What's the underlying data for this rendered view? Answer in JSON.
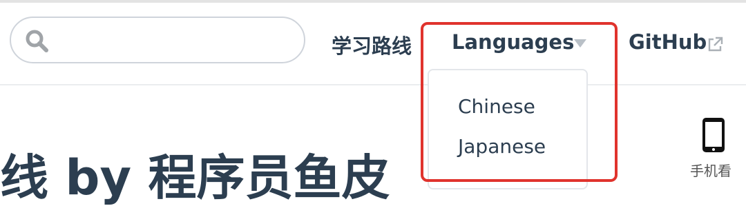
{
  "search": {
    "value": "",
    "placeholder": "",
    "icon": "search-icon"
  },
  "navbar": {
    "learning_path": "学习路线",
    "languages": "Languages",
    "github": "GitHub",
    "dropdown_icon": "caret-down-icon",
    "external_icon": "external-link-icon"
  },
  "languages_menu": {
    "items": [
      {
        "label": "Chinese"
      },
      {
        "label": "Japanese"
      }
    ]
  },
  "page": {
    "title": "线 by 程序员鱼皮"
  },
  "mobile": {
    "icon": "phone-icon",
    "label": "手机看"
  },
  "colors": {
    "text": "#2c3e50",
    "highlight": "#e0332d",
    "border": "#cfd4db"
  }
}
